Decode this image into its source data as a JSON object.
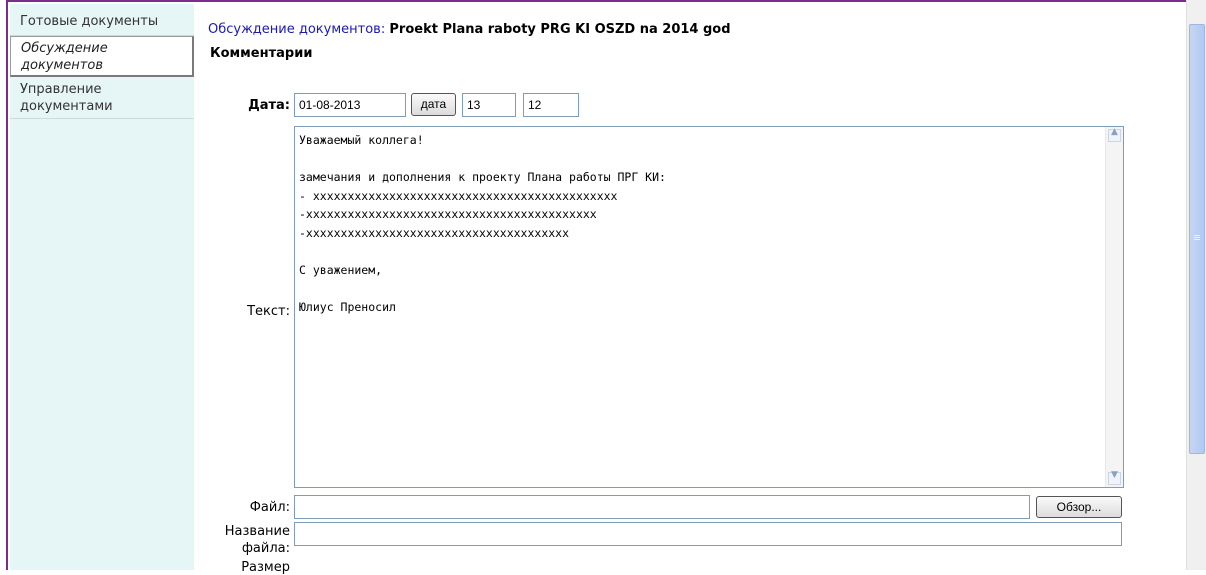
{
  "sidebar": {
    "items": [
      {
        "label_lines": [
          "Готовые документы"
        ],
        "active": false
      },
      {
        "label_lines": [
          "Обсуждение",
          "документов"
        ],
        "active": true
      },
      {
        "label_lines": [
          "Управление",
          "документами"
        ],
        "active": false
      }
    ]
  },
  "breadcrumb": {
    "link": "Обсуждение документов",
    "separator": ":",
    "title": "Proekt Plana raboty PRG KI OSZD na 2014 god"
  },
  "section_title": "Комментарии",
  "form": {
    "date_label": "Дата:",
    "date_value": "01-08-2013",
    "date_button": "дата",
    "hour_value": "13",
    "minute_value": "12",
    "text_label": "Текст:",
    "text_value": "Уважаемый коллега!\n\nзамечания и дополнения к проекту Плана работы ПРГ КИ:\n- xxxxxxxxxxxxxxxxxxxxxxxxxxxxxxxxxxxxxxxxxxxx\n-xxxxxxxxxxxxxxxxxxxxxxxxxxxxxxxxxxxxxxxxxx\n-xxxxxxxxxxxxxxxxxxxxxxxxxxxxxxxxxxxxxx\n\nС уважением,\n\nЮлиус Преносил",
    "file_label": "Файл:",
    "file_value": "",
    "browse_button": "Обзор...",
    "filename_label_lines": [
      "Название",
      "файла:"
    ],
    "filename_value": "",
    "size_label": "Размер"
  },
  "colors": {
    "frame": "#7b2d8b",
    "sidebar_bg": "#e6f5f5",
    "link": "#1a1ab0",
    "input_border": "#7f9db9",
    "scroll_thumb": "#b8ccf2"
  }
}
